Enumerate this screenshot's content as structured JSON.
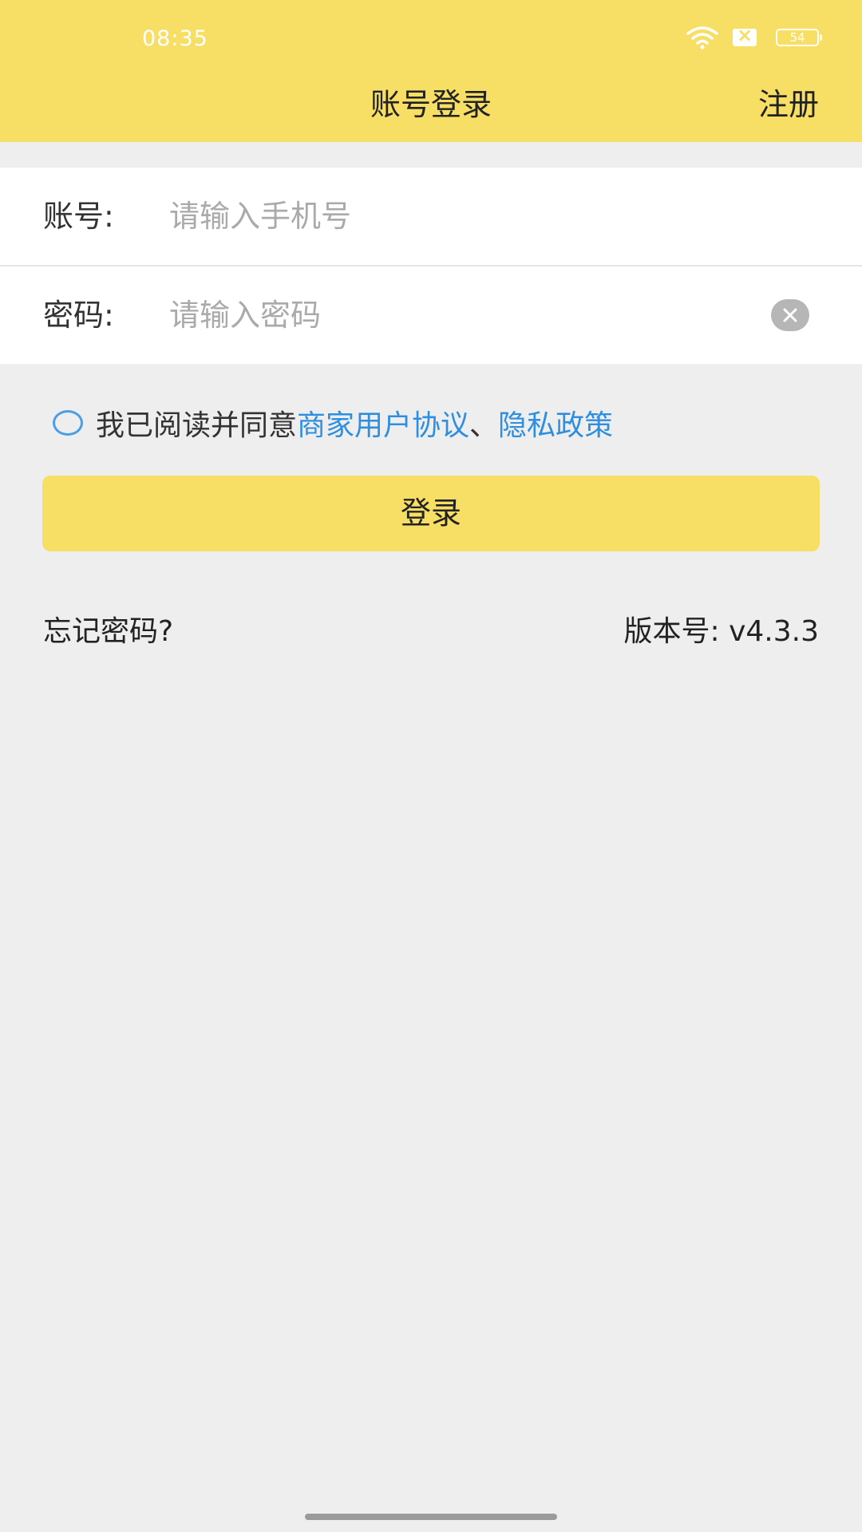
{
  "status_bar": {
    "time": "08:35",
    "battery_level": "54"
  },
  "header": {
    "title": "账号登录",
    "register_label": "注册",
    "background_color": "#f7df66"
  },
  "form": {
    "account": {
      "label": "账号:",
      "placeholder": "请输入手机号"
    },
    "password": {
      "label": "密码:",
      "placeholder": "请输入密码"
    }
  },
  "agreement": {
    "prefix": "我已阅读并同意",
    "user_agreement_link": "商家用户协议",
    "separator": "、",
    "privacy_policy_link": "隐私政策",
    "checked": false,
    "link_color": "#2e8fe0"
  },
  "login_button": {
    "label": "登录"
  },
  "footer": {
    "forgot_password_label": "忘记密码?",
    "version_label": "版本号: v4.3.3"
  },
  "icons": [
    "wifi-icon",
    "sim-error-icon",
    "battery-icon",
    "clear-icon",
    "checkbox-circle-icon"
  ]
}
